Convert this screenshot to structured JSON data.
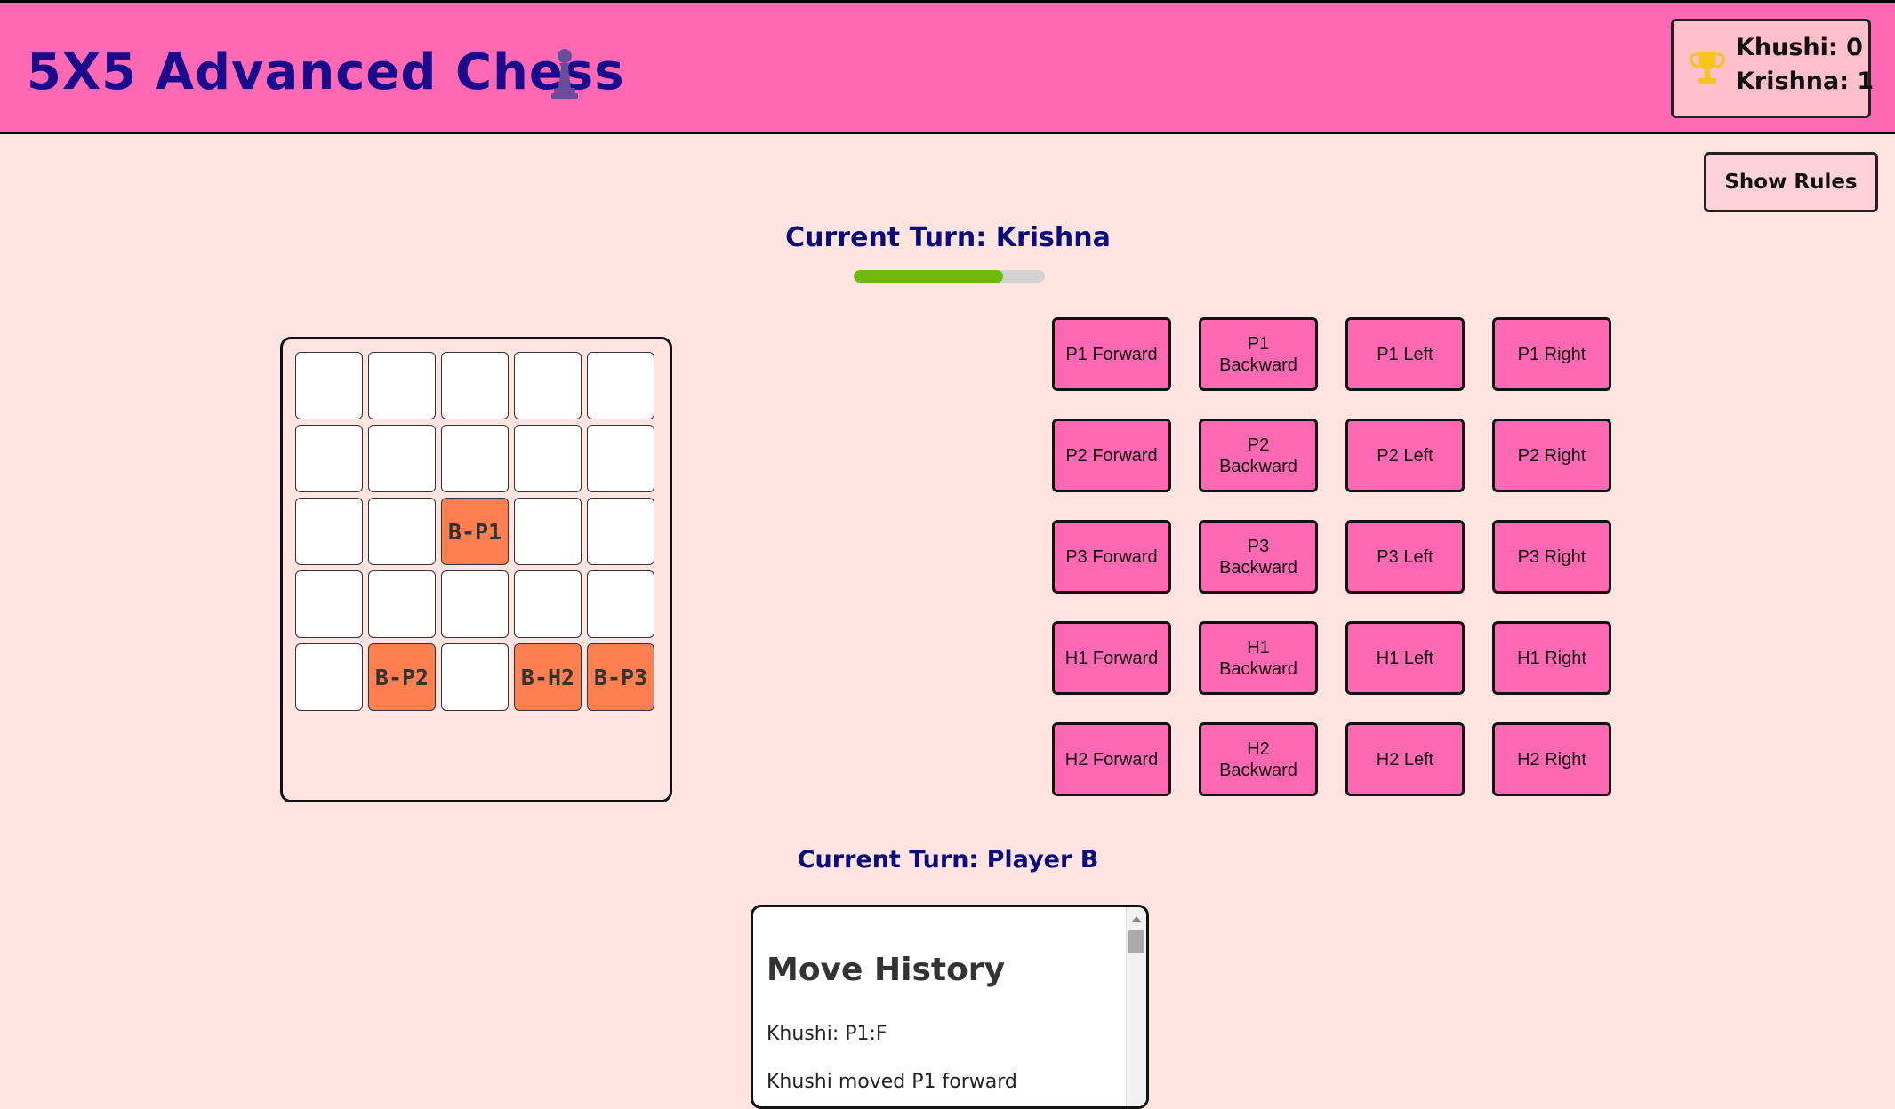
{
  "header": {
    "title": "5X5 Advanced Chess",
    "title_icon": "chess-pawn-icon",
    "scores": [
      {
        "label": "Khushi: 0"
      },
      {
        "label": "Krishna: 1"
      }
    ],
    "score_icon": "trophy-icon"
  },
  "rules_button": {
    "label": "Show Rules"
  },
  "turn": {
    "current": "Current Turn: Krishna",
    "timer_fraction": 0.78,
    "timer_color": "#6cbb0a",
    "player_turn": "Current Turn: Player B"
  },
  "board": {
    "rows": [
      [
        "",
        "",
        "",
        "",
        ""
      ],
      [
        "",
        "",
        "",
        "",
        ""
      ],
      [
        "",
        "",
        "B-P1",
        "",
        ""
      ],
      [
        "",
        "",
        "",
        "",
        ""
      ],
      [
        "",
        "B-P2",
        "",
        "B-H2",
        "B-P3"
      ]
    ],
    "piece_color": "#ff7f50"
  },
  "moves": {
    "rows": [
      [
        "P1 Forward",
        "P1 Backward",
        "P1 Left",
        "P1 Right"
      ],
      [
        "P2 Forward",
        "P2 Backward",
        "P2 Left",
        "P2 Right"
      ],
      [
        "P3 Forward",
        "P3 Backward",
        "P3 Left",
        "P3 Right"
      ],
      [
        "H1 Forward",
        "H1 Backward",
        "H1 Left",
        "H1 Right"
      ],
      [
        "H2 Forward",
        "H2 Backward",
        "H2 Left",
        "H2 Right"
      ]
    ],
    "button_color": "#ff69b4"
  },
  "history": {
    "title": "Move History",
    "entries": [
      "Khushi: P1:F",
      "Khushi moved P1 forward"
    ]
  }
}
